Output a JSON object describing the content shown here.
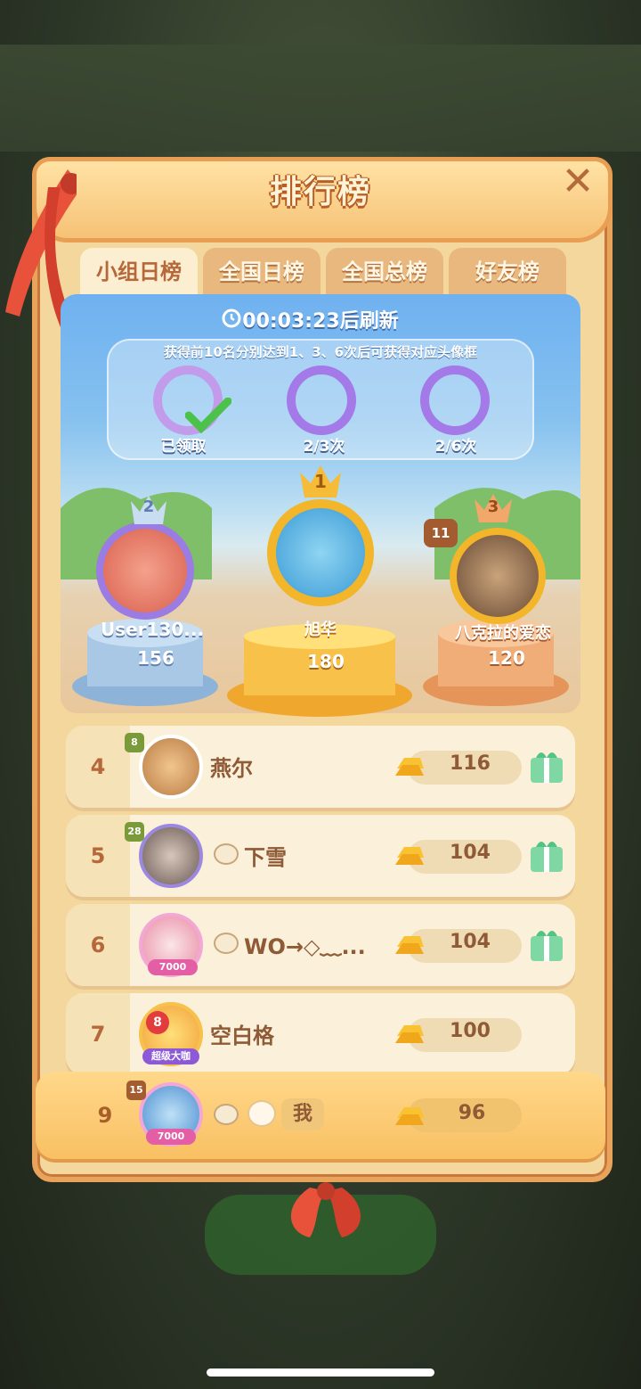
{
  "title": "排行榜",
  "close_icon": "close-icon",
  "tabs": [
    {
      "label": "小组日榜",
      "active": true
    },
    {
      "label": "全国日榜",
      "active": false
    },
    {
      "label": "全国总榜",
      "active": false
    },
    {
      "label": "好友榜",
      "active": false
    }
  ],
  "timer": {
    "text": "00:03:23后刷新"
  },
  "reward": {
    "desc": "获得前10名分别达到1、3、6次后可获得对应头像框",
    "frames": [
      {
        "label": "已领取",
        "claimed": true
      },
      {
        "label": "2/3次",
        "claimed": false
      },
      {
        "label": "2/6次",
        "claimed": false
      }
    ]
  },
  "podium": {
    "first": {
      "rank": "1",
      "name": "旭华",
      "score": "180"
    },
    "second": {
      "rank": "2",
      "name": "User130...",
      "score": "156"
    },
    "third": {
      "rank": "3",
      "name": "八克拉的爱恋",
      "score": "120",
      "level": "11"
    }
  },
  "rows": [
    {
      "rank": "4",
      "name": "燕尔",
      "score": "116",
      "level": "8",
      "gift": true
    },
    {
      "rank": "5",
      "name": "下雪",
      "score": "104",
      "level": "28",
      "gift": true
    },
    {
      "rank": "6",
      "name": "WO→◇﹏...",
      "score": "104",
      "badge": "7000",
      "gift": true
    },
    {
      "rank": "7",
      "name": "空白格",
      "score": "100",
      "badge": "8",
      "badge_text": "超级大咖",
      "gift": false
    }
  ],
  "me": {
    "rank": "9",
    "name": "我",
    "score": "96",
    "level": "15",
    "badge": "7000"
  },
  "colors": {
    "panel": "#f4d79d",
    "accent": "#e89e53",
    "text": "#8f5a36",
    "frame": "#a37ae8"
  }
}
